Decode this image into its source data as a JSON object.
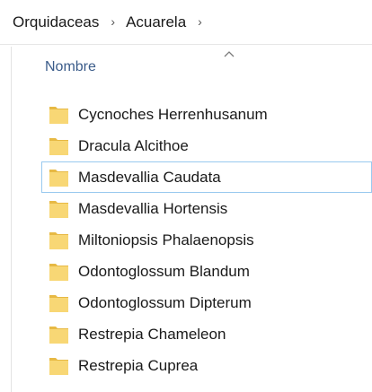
{
  "breadcrumb": {
    "items": [
      {
        "label": "Orquidaceas"
      },
      {
        "label": "Acuarela"
      }
    ],
    "separator": "›"
  },
  "column_header": {
    "label": "Nombre",
    "sort_icon": "chevron-up-icon"
  },
  "folders": [
    {
      "name": "Cycnoches Herrenhusanum"
    },
    {
      "name": "Dracula Alcithoe"
    },
    {
      "name": "Masdevallia Caudata"
    },
    {
      "name": "Masdevallia Hortensis"
    },
    {
      "name": "Miltoniopsis Phalaenopsis"
    },
    {
      "name": "Odontoglossum Blandum"
    },
    {
      "name": "Odontoglossum Dipterum"
    },
    {
      "name": "Restrepia Chameleon"
    },
    {
      "name": "Restrepia Cuprea"
    }
  ],
  "focused_folder": "Masdevallia Caudata",
  "colors": {
    "folder": "#f8d775",
    "folder_shade": "#e7b944",
    "header_text": "#3b5c8a",
    "focus_border": "#99c9ef"
  }
}
